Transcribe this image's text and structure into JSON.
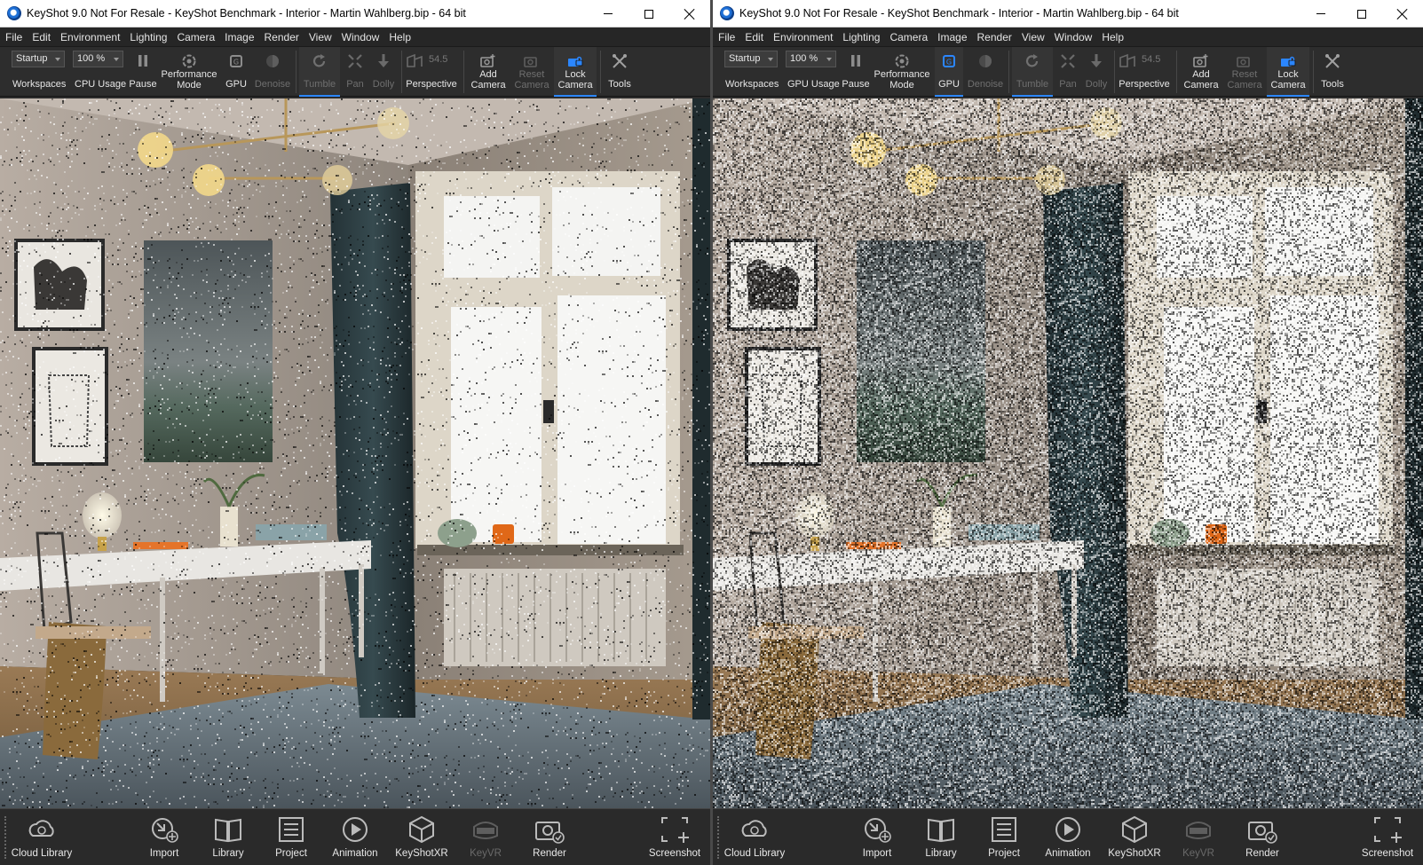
{
  "windows": [
    {
      "id": "cpu",
      "title": "KeyShot 9.0 Not For Resale  - KeyShot Benchmark - Interior - Martin Wahlberg.bip  - 64 bit",
      "menu": [
        "File",
        "Edit",
        "Environment",
        "Lighting",
        "Camera",
        "Image",
        "Render",
        "View",
        "Window",
        "Help"
      ],
      "toolbar": {
        "workspace_value": "Startup",
        "workspace_label": "Workspaces",
        "usage_value": "100 %",
        "usage_label": "CPU Usage",
        "pause_label": "Pause",
        "performance_label_1": "Performance",
        "performance_label_2": "Mode",
        "gpu_label": "GPU",
        "gpu_active": false,
        "denoise_label": "Denoise",
        "tumble_label": "Tumble",
        "pan_label": "Pan",
        "dolly_label": "Dolly",
        "fov_value": "54.5",
        "perspective_label": "Perspective",
        "add_camera_1": "Add",
        "add_camera_2": "Camera",
        "reset_camera_1": "Reset",
        "reset_camera_2": "Camera",
        "lock_camera_1": "Lock",
        "lock_camera_2": "Camera",
        "tools_label": "Tools"
      },
      "render_noise": 0.05,
      "ribbon": {
        "cloud_library": "Cloud Library",
        "import": "Import",
        "library": "Library",
        "project": "Project",
        "animation": "Animation",
        "keyshotxr": "KeyShotXR",
        "keyvr": "KeyVR",
        "render": "Render",
        "screenshot": "Screenshot"
      }
    },
    {
      "id": "gpu",
      "title": "KeyShot 9.0 Not For Resale  - KeyShot Benchmark - Interior - Martin Wahlberg.bip  - 64 bit",
      "menu": [
        "File",
        "Edit",
        "Environment",
        "Lighting",
        "Camera",
        "Image",
        "Render",
        "View",
        "Window",
        "Help"
      ],
      "toolbar": {
        "workspace_value": "Startup",
        "workspace_label": "Workspaces",
        "usage_value": "100 %",
        "usage_label": "GPU Usage",
        "pause_label": "Pause",
        "performance_label_1": "Performance",
        "performance_label_2": "Mode",
        "gpu_label": "GPU",
        "gpu_active": true,
        "denoise_label": "Denoise",
        "tumble_label": "Tumble",
        "pan_label": "Pan",
        "dolly_label": "Dolly",
        "fov_value": "54.5",
        "perspective_label": "Perspective",
        "add_camera_1": "Add",
        "add_camera_2": "Camera",
        "reset_camera_1": "Reset",
        "reset_camera_2": "Camera",
        "lock_camera_1": "Lock",
        "lock_camera_2": "Camera",
        "tools_label": "Tools"
      },
      "render_noise": 0.55,
      "ribbon": {
        "cloud_library": "Cloud Library",
        "import": "Import",
        "library": "Library",
        "project": "Project",
        "animation": "Animation",
        "keyshotxr": "KeyShotXR",
        "keyvr": "KeyVR",
        "render": "Render",
        "screenshot": "Screenshot"
      }
    }
  ],
  "colors": {
    "accent": "#2b86ff",
    "titlebar": "#ffffff",
    "toolbar": "#2d2d2d",
    "ribbon": "#2a2a2a"
  }
}
